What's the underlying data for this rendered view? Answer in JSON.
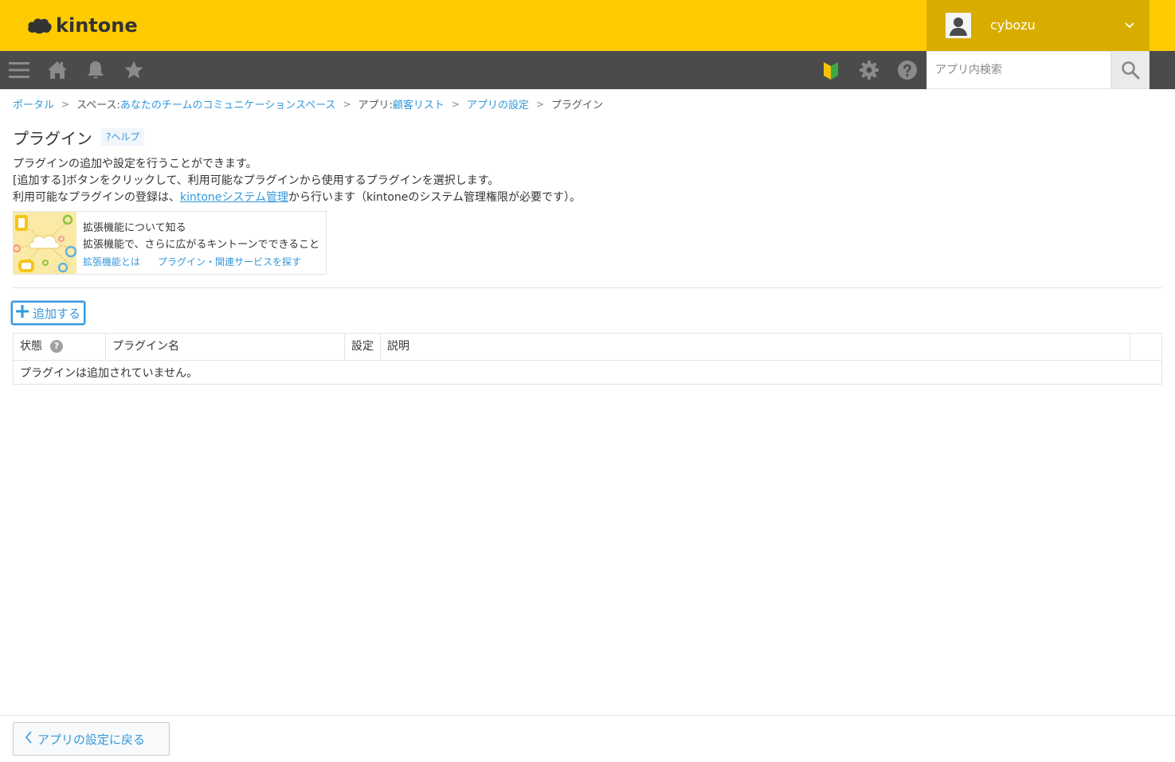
{
  "app": {
    "logo_text": "kintone",
    "brand_color": "#fdcb00"
  },
  "user": {
    "name": "cybozu",
    "avatar_icon": "user-icon",
    "menu_icon": "chevron-down-icon"
  },
  "toolbar": {
    "menu_icon": "menu-icon",
    "home_icon": "home-icon",
    "notification_icon": "bell-icon",
    "favorite_icon": "star-icon",
    "beginner_icon": "beginner-mark-icon",
    "settings_icon": "gear-icon",
    "help_icon": "question-icon"
  },
  "search": {
    "placeholder": "アプリ内検索",
    "button_icon": "search-icon"
  },
  "breadcrumb": {
    "portal": "ポータル",
    "space_prefix": "スペース: ",
    "space": "あなたのチームのコミュニケーションスペース",
    "app_prefix": "アプリ: ",
    "app": "顧客リスト",
    "app_settings": "アプリの設定",
    "current": "プラグイン",
    "separator": ">"
  },
  "page": {
    "title": "プラグイン",
    "help": "?ヘルプ",
    "desc_line1": "プラグインの追加や設定を行うことができます。",
    "desc_line2": "[追加する]ボタンをクリックして、利用可能なプラグインから使用するプラグインを選択します。",
    "desc_line3_pre": "利用可能なプラグインの登録は、",
    "desc_line3_link": "kintoneシステム管理",
    "desc_line3_post": "から行います（kintoneのシステム管理権限が必要です）。"
  },
  "extension": {
    "title": "拡張機能について知る",
    "subtitle": "拡張機能で、さらに広がるキントーンでできること",
    "link1": "拡張機能とは",
    "link2": "プラグイン・関連サービスを探す"
  },
  "actions": {
    "add": "追加する"
  },
  "table": {
    "headers": [
      "状態",
      "プラグイン名",
      "設定",
      "説明"
    ],
    "empty": "プラグインは追加されていません。"
  },
  "footer": {
    "back": "アプリの設定に戻る"
  }
}
